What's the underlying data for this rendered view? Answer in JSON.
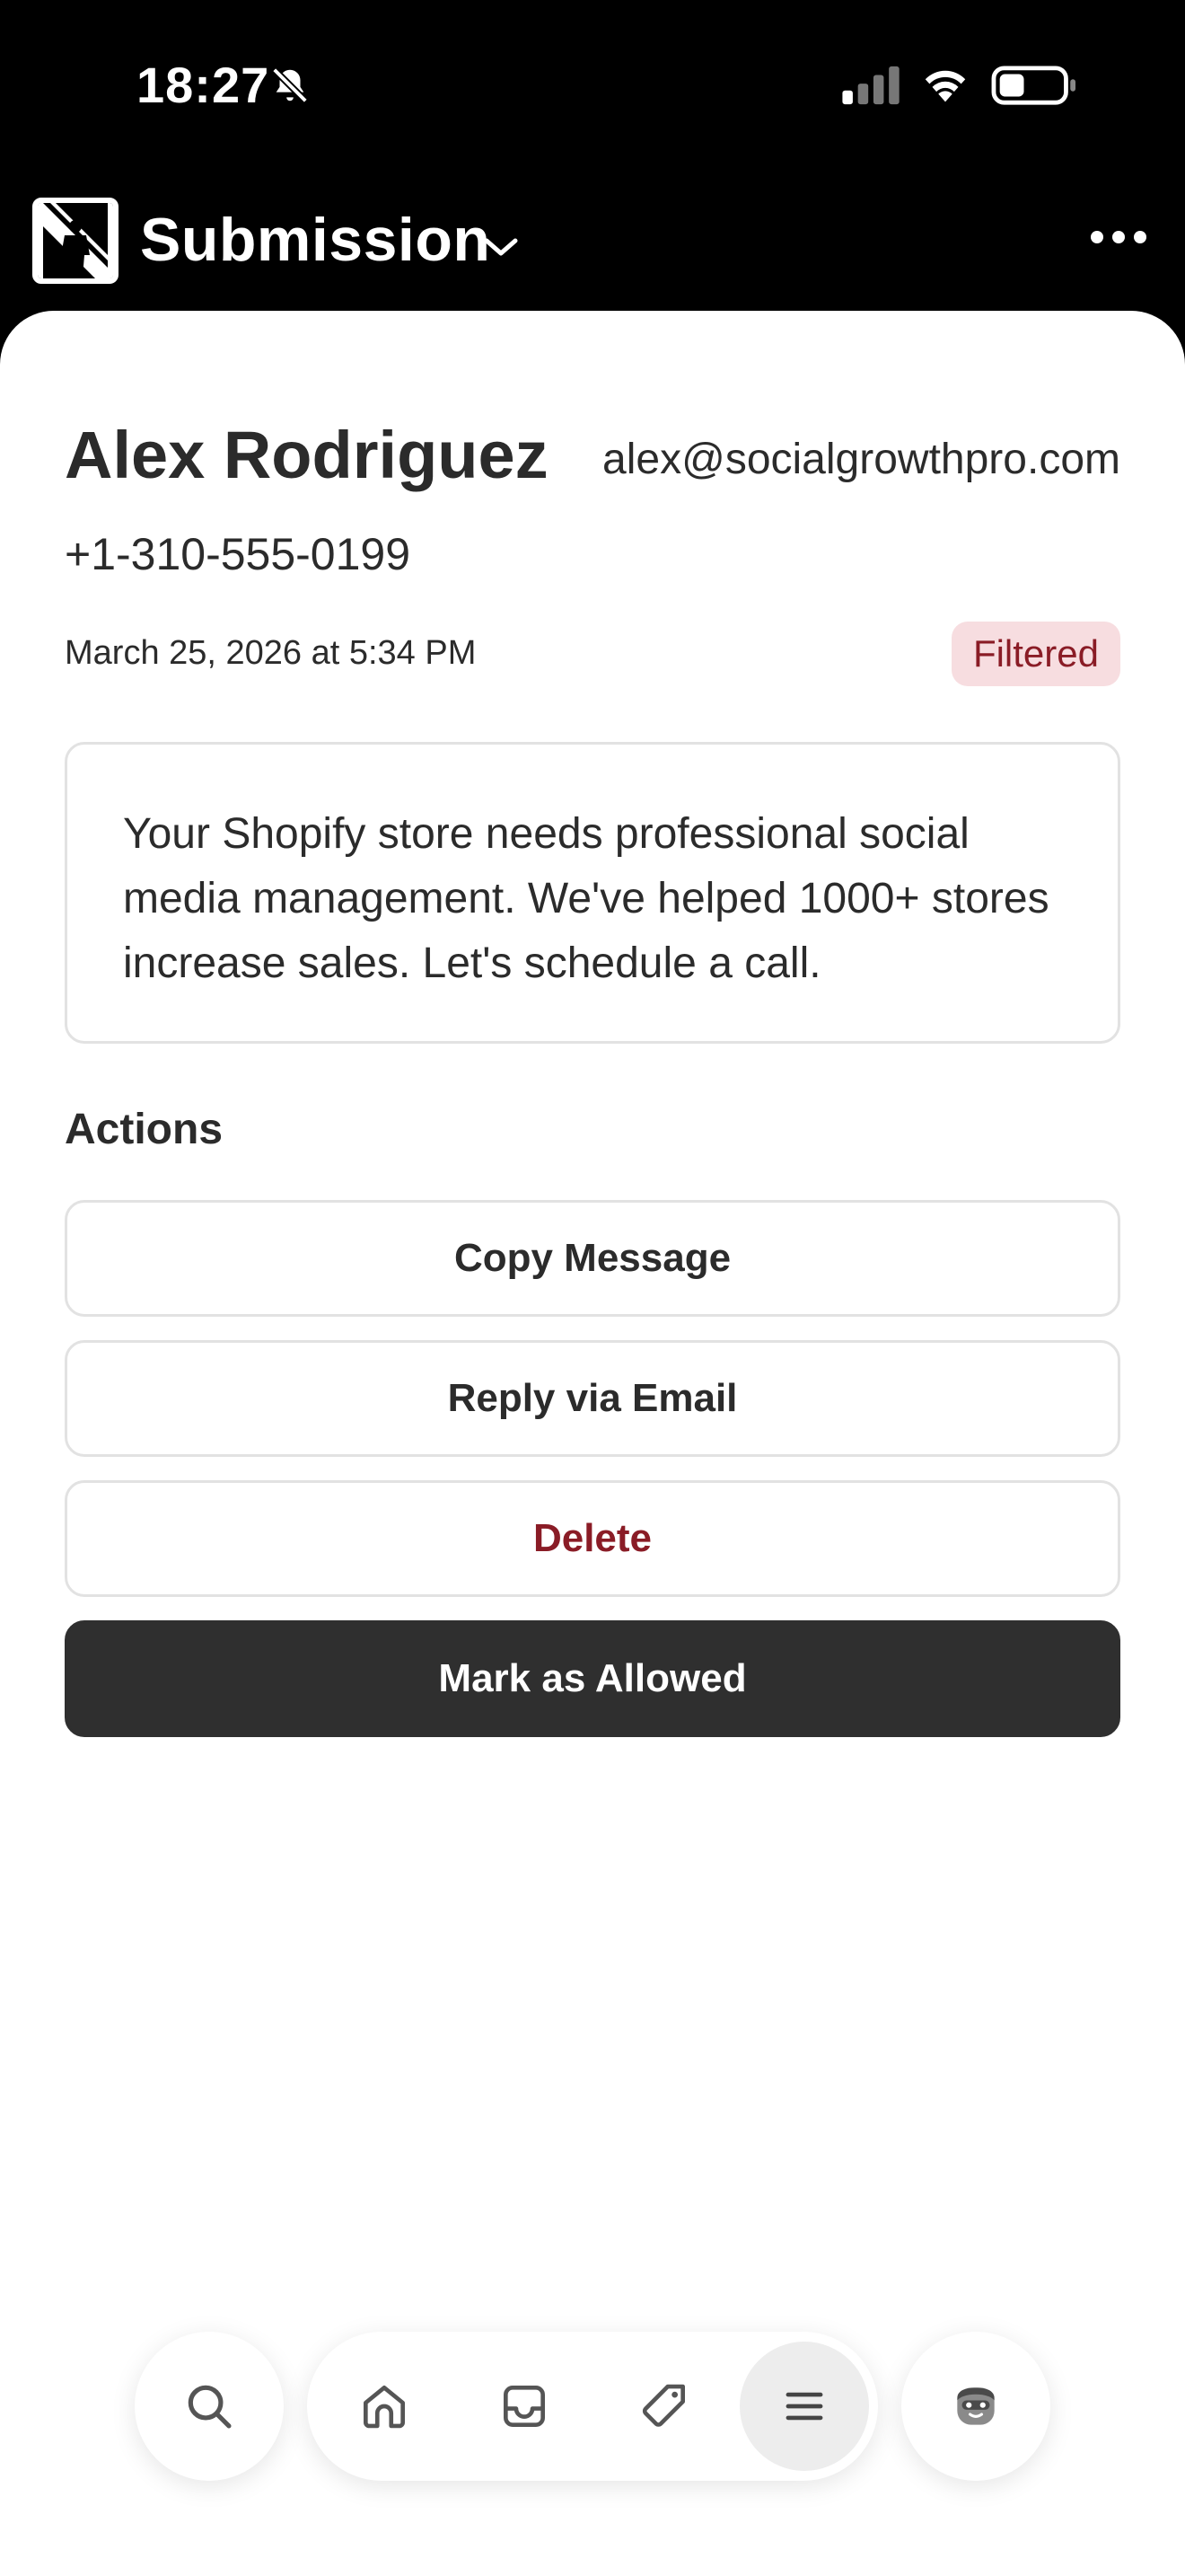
{
  "status_bar": {
    "time": "18:27",
    "icons": [
      "bell-slash-icon",
      "cellular-signal-icon",
      "wifi-icon",
      "battery-icon"
    ]
  },
  "header": {
    "title": "Submission",
    "logo": "app-logo",
    "menu_icon": "more-icon"
  },
  "submission": {
    "name": "Alex Rodriguez",
    "email": "alex@socialgrowthpro.com",
    "phone": "+1-310-555-0199",
    "timestamp": "March 25, 2026 at 5:34 PM",
    "status": "Filtered",
    "message": "Your Shopify store needs professional social media management. We've helped 1000+ stores increase sales. Let's schedule a call."
  },
  "actions": {
    "heading": "Actions",
    "copy_label": "Copy Message",
    "reply_label": "Reply via Email",
    "delete_label": "Delete",
    "allow_label": "Mark as Allowed"
  },
  "bottom_nav": {
    "items": [
      "search-icon",
      "home-icon",
      "inbox-icon",
      "tag-icon",
      "menu-icon",
      "avatar-icon"
    ],
    "active": "menu-icon"
  },
  "colors": {
    "header_bg": "#000000",
    "badge_bg": "#f7dde0",
    "badge_text": "#8a1c26",
    "delete_text": "#8a1c26",
    "primary_button": "#2f2f2f"
  }
}
